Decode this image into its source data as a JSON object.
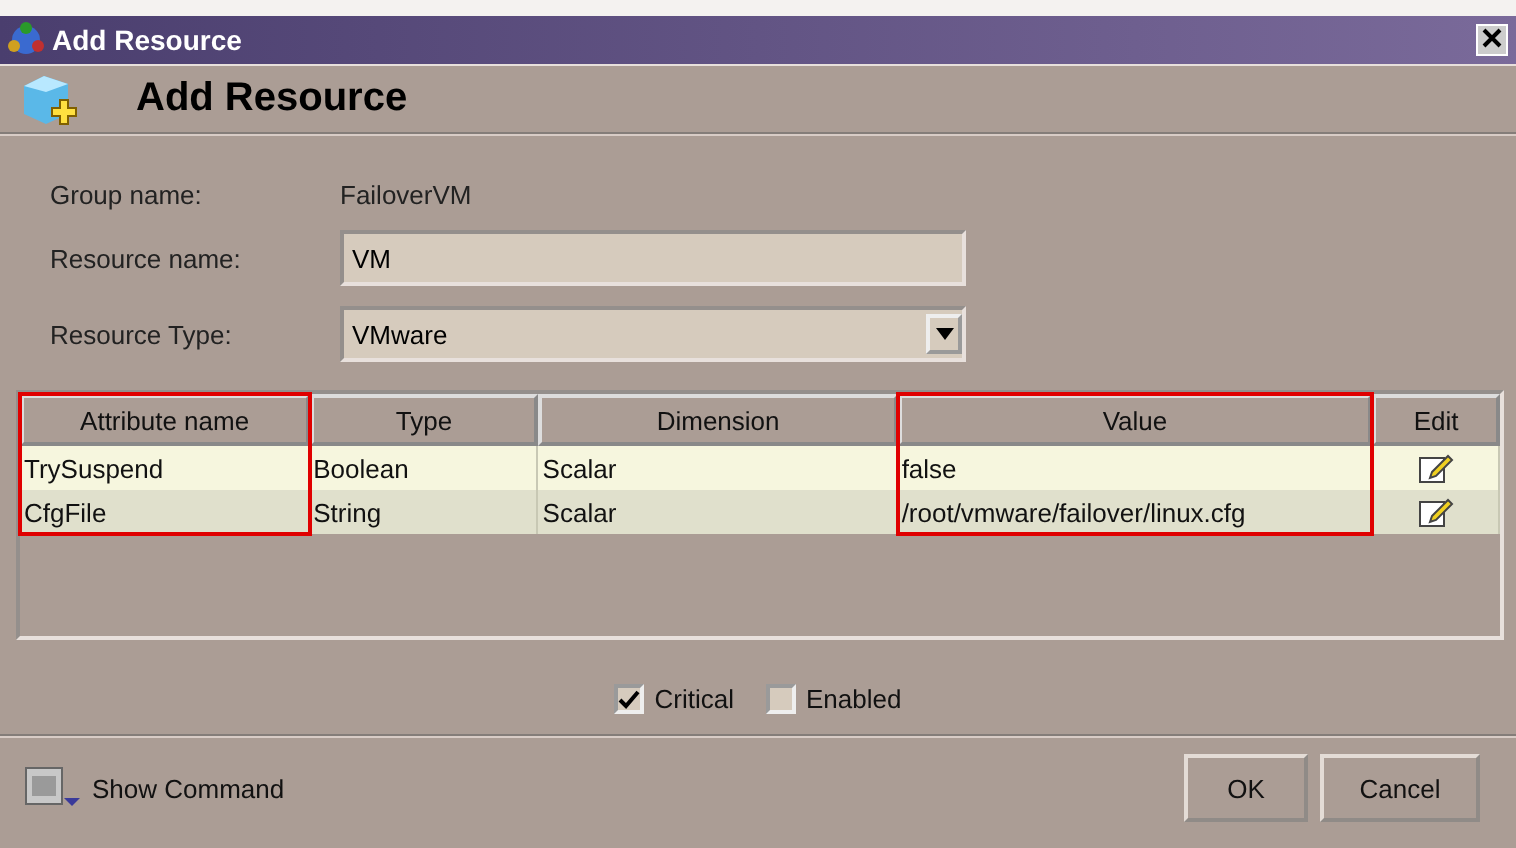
{
  "window": {
    "title": "Add Resource"
  },
  "header": {
    "title": "Add Resource"
  },
  "form": {
    "group_label": "Group name:",
    "group_value": "FailoverVM",
    "name_label": "Resource name:",
    "name_value": "VM",
    "type_label": "Resource Type:",
    "type_value": "VMware"
  },
  "table": {
    "columns": [
      {
        "label": "Attribute name",
        "highlighted": true
      },
      {
        "label": "Type",
        "highlighted": false
      },
      {
        "label": "Dimension",
        "highlighted": false
      },
      {
        "label": "Value",
        "highlighted": true
      },
      {
        "label": "Edit",
        "highlighted": false
      }
    ],
    "rows": [
      [
        "TrySuspend",
        "Boolean",
        "Scalar",
        "false"
      ],
      [
        "CfgFile",
        "String",
        "Scalar",
        "/root/vmware/failover/linux.cfg"
      ]
    ]
  },
  "options": [
    {
      "label": "Critical",
      "checked": true
    },
    {
      "label": "Enabled",
      "checked": false
    }
  ],
  "footer": {
    "show_command": "Show Command",
    "buttons": [
      "OK",
      "Cancel"
    ]
  }
}
